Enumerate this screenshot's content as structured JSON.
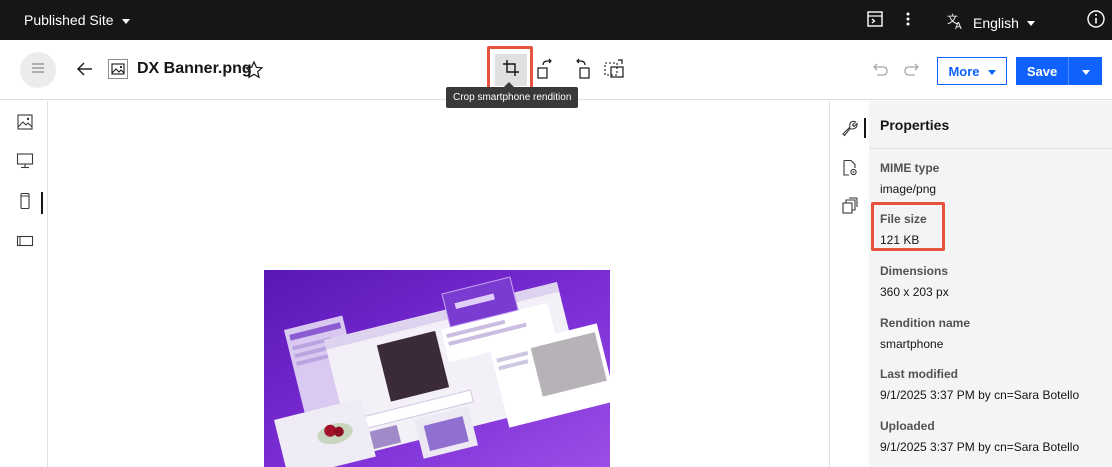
{
  "topbar": {
    "site_label": "Published Site",
    "language_label": "English",
    "icons": [
      "terminal-icon",
      "more-vertical-icon",
      "translate-icon",
      "info-icon"
    ]
  },
  "toolbar": {
    "file_name": "DX Banner.png",
    "more_label": "More",
    "save_label": "Save",
    "tooltip": "Crop smartphone rendition",
    "icons": [
      "menu-icon",
      "back-arrow-icon",
      "image-file-icon",
      "star-icon",
      "crop-icon",
      "rotate-left-icon",
      "rotate-right-icon",
      "resize-icon",
      "undo-icon",
      "redo-icon"
    ]
  },
  "left_rail": {
    "items": [
      "image-rendition-icon",
      "desktop-icon",
      "smartphone-icon",
      "tablet-icon"
    ],
    "selected": "smartphone-icon"
  },
  "side_rail": {
    "items": [
      "wrench-icon",
      "file-settings-icon",
      "copy-icon"
    ],
    "selected": "wrench-icon"
  },
  "properties": {
    "title": "Properties",
    "items": [
      {
        "label": "MIME type",
        "value": "image/png"
      },
      {
        "label": "File size",
        "value": "121 KB"
      },
      {
        "label": "Dimensions",
        "value": "360 x 203 px"
      },
      {
        "label": "Rendition name",
        "value": "smartphone"
      },
      {
        "label": "Last modified",
        "value": "9/1/2025 3:37 PM by cn=Sara Botello"
      },
      {
        "label": "Uploaded",
        "value": "9/1/2025 3:37 PM by cn=Sara Botello"
      }
    ]
  },
  "preview": {
    "ui_texts": [
      "Upload",
      "Thomas Crafter.png",
      "Search for content and templates",
      "Libraries",
      "green bow.jpg"
    ]
  },
  "colors": {
    "accent": "#0f62fe",
    "topbar": "#161616",
    "highlight": "#e5533f",
    "image_purple": "#6a1bc9"
  }
}
